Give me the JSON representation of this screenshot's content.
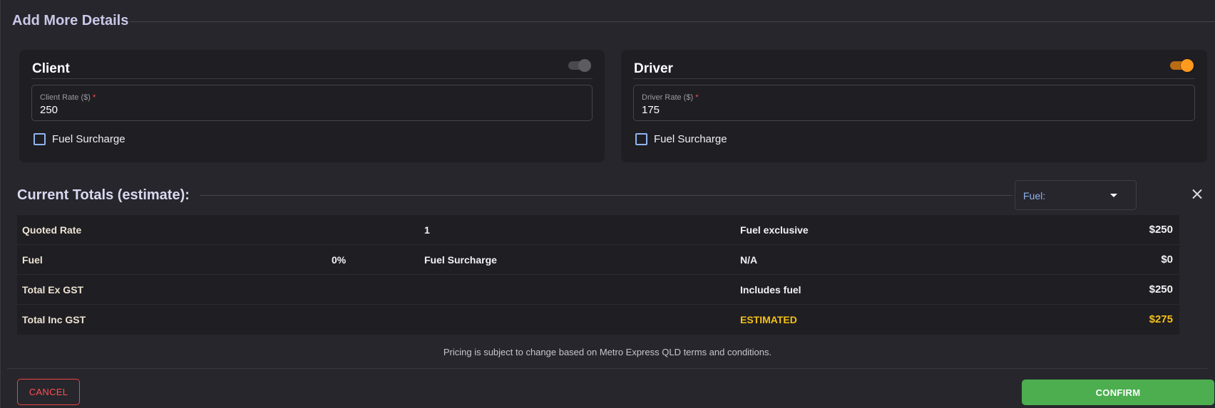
{
  "header": {
    "title": "Add More Details"
  },
  "client": {
    "title": "Client",
    "toggle_on": false,
    "rate_label": "Client Rate ($)",
    "required_mark": "*",
    "rate_value": "250",
    "fuel_surcharge_label": "Fuel Surcharge"
  },
  "driver": {
    "title": "Driver",
    "toggle_on": true,
    "rate_label": "Driver Rate ($)",
    "required_mark": "*",
    "rate_value": "175",
    "fuel_surcharge_label": "Fuel Surcharge"
  },
  "totals": {
    "title": "Current Totals (estimate):",
    "fuel_select_label": "Fuel:",
    "rows": [
      {
        "label": "Quoted Rate",
        "col2": "",
        "col3": "1",
        "col4": "Fuel exclusive",
        "amount": "$250"
      },
      {
        "label": "Fuel",
        "col2": "0%",
        "col3": "Fuel Surcharge",
        "col4": "N/A",
        "amount": "$0"
      },
      {
        "label": "Total Ex GST",
        "col2": "",
        "col3": "",
        "col4": "Includes fuel",
        "amount": "$250"
      },
      {
        "label": "Total Inc GST",
        "col2": "",
        "col3": "",
        "col4": "ESTIMATED",
        "amount": "$275"
      }
    ]
  },
  "disclaimer": "Pricing is subject to change based on Metro Express QLD terms and conditions.",
  "actions": {
    "cancel_label": "CANCEL",
    "confirm_label": "CONFIRM"
  },
  "colors": {
    "background": "#27262c",
    "card": "#1f1e23",
    "accent_orange": "#ff9a1f",
    "accent_yellow": "#f4c01a",
    "confirm_green": "#4cae4f",
    "cancel_red": "#ff5050",
    "link_blue": "#8fb4f0"
  }
}
